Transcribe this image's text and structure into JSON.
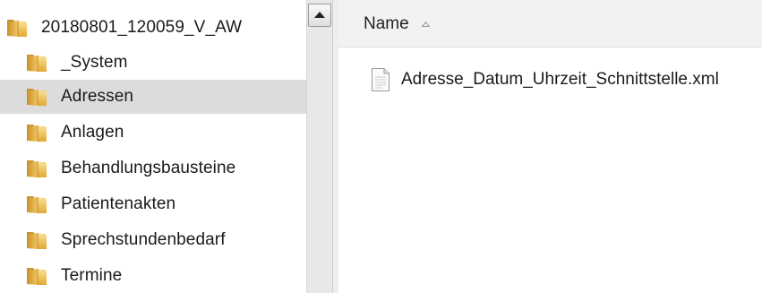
{
  "tree": {
    "root": {
      "label": "20180801_120059_V_AW",
      "icon": "folder-icon"
    },
    "items": [
      {
        "label": "_System",
        "icon": "folder-icon",
        "selected": false
      },
      {
        "label": "Adressen",
        "icon": "folder-icon",
        "selected": true
      },
      {
        "label": "Anlagen",
        "icon": "folder-icon",
        "selected": false
      },
      {
        "label": "Behandlungsbausteine",
        "icon": "folder-icon",
        "selected": false
      },
      {
        "label": "Patientenakten",
        "icon": "folder-icon",
        "selected": false
      },
      {
        "label": "Sprechstundenbedarf",
        "icon": "folder-icon",
        "selected": false
      },
      {
        "label": "Termine",
        "icon": "folder-icon",
        "selected": false
      }
    ]
  },
  "file_list": {
    "columns": [
      {
        "label": "Name",
        "sort": "ascending"
      }
    ],
    "files": [
      {
        "name": "Adresse_Datum_Uhrzeit_Schnittstelle.xml",
        "icon": "xml-file-icon"
      }
    ]
  },
  "colors": {
    "selection": "#dcdcdc",
    "folder": "#e8b84a",
    "header_bg": "#f2f2f2"
  }
}
